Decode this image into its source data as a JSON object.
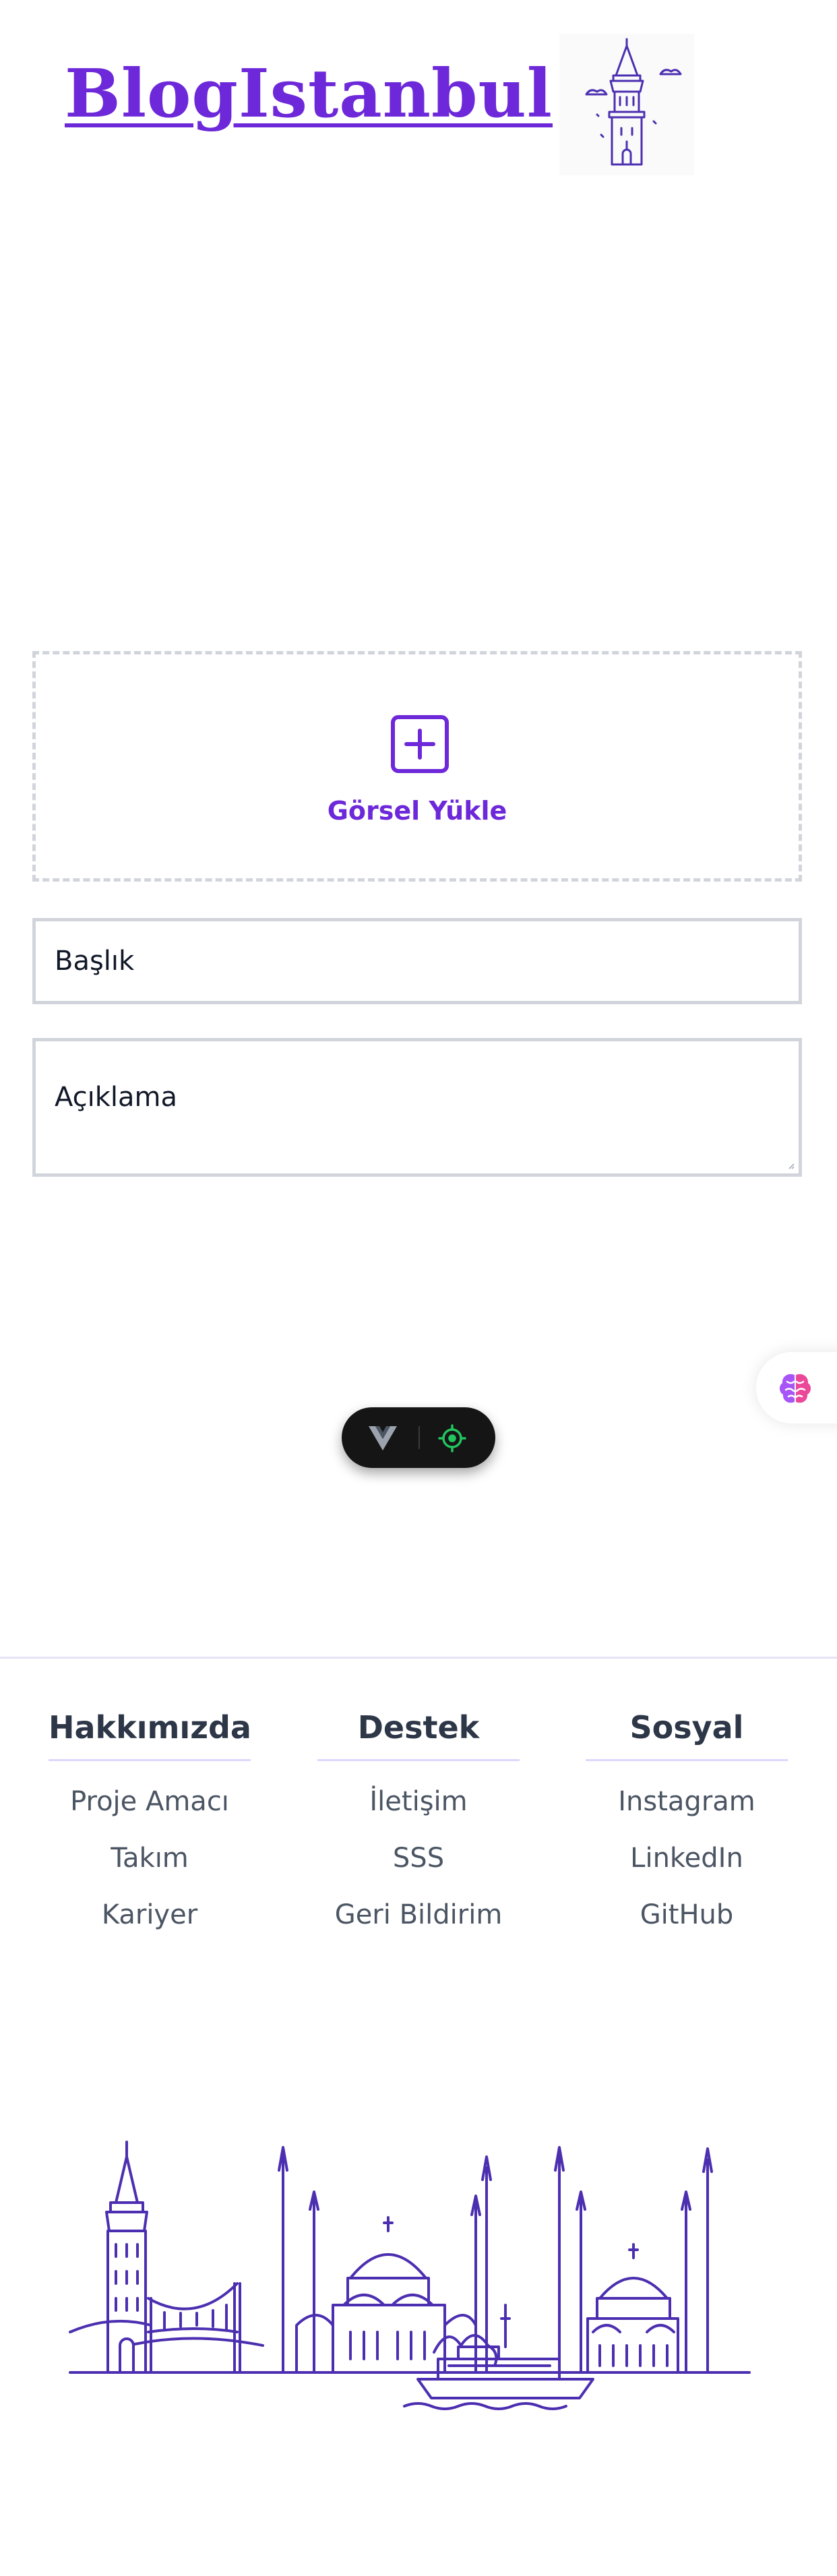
{
  "header": {
    "brand": "BlogIstanbul",
    "logo_icon": "galata-tower-icon"
  },
  "form": {
    "upload_label": "Görsel Yükle",
    "upload_icon": "plus-square-icon",
    "title_placeholder": "Başlık",
    "description_placeholder": "Açıklama"
  },
  "devtools": {
    "vue_icon": "vue-logo-icon",
    "inspect_icon": "target-icon"
  },
  "assistant": {
    "icon": "brain-icon"
  },
  "footer": {
    "columns": [
      {
        "title": "Hakkımızda",
        "links": [
          "Proje Amacı",
          "Takım",
          "Kariyer"
        ]
      },
      {
        "title": "Destek",
        "links": [
          "İletişim",
          "SSS",
          "Geri Bildirim"
        ]
      },
      {
        "title": "Sosyal",
        "links": [
          "Instagram",
          "LinkedIn",
          "GitHub"
        ]
      }
    ],
    "illustration": "istanbul-skyline-icon"
  },
  "colors": {
    "brand": "#6d28d9",
    "illustration": "#4c2fb0",
    "border": "#d1d5db",
    "devtools_green": "#22c55e"
  }
}
